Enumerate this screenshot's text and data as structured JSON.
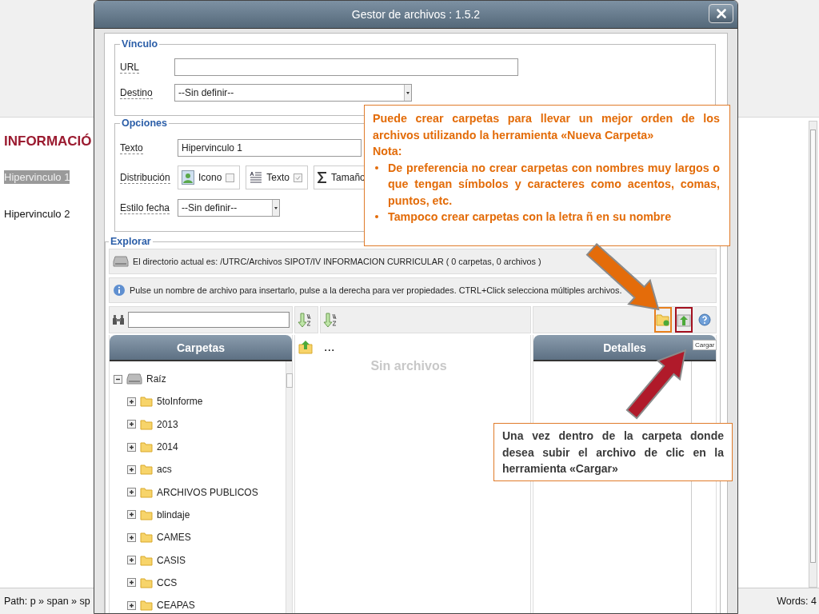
{
  "editor": {
    "heading": "INFORMACIÓ",
    "links": [
      {
        "text": "Hipervinculo 1",
        "selected": true
      },
      {
        "text": "Hipervinculo 2",
        "selected": false
      }
    ],
    "status_path": "Path: p » span » sp",
    "word_count": "Words: 4"
  },
  "dialog": {
    "title": "Gestor de archivos : 1.5.2",
    "vinculo": {
      "legend": "Vínculo",
      "url_label": "URL",
      "destino_label": "Destino",
      "destino_value": "--Sin definir--"
    },
    "opciones": {
      "legend": "Opciones",
      "texto_label": "Texto",
      "texto_value": "Hipervinculo 1",
      "distribucion_label": "Distribución",
      "distribucion": [
        {
          "kind": "icon",
          "label": "Icono",
          "checked": false
        },
        {
          "kind": "text",
          "label": "Texto",
          "checked": true
        },
        {
          "kind": "size",
          "label": "Tamaño"
        }
      ],
      "fecha_label": "Estilo fecha",
      "fecha_value": "--Sin definir--"
    },
    "explorar": {
      "legend": "Explorar",
      "directory": "El directorio actual es: /UTRC/Archivos SIPOT/IV INFORMACION CURRICULAR ( 0 carpetas, 0 archivos )",
      "info": "Pulse un nombre de archivo para insertarlo, pulse a la derecha para ver propiedades. CTRL+Click selecciona múltiples archivos.",
      "tools": [
        {
          "kind": "new-folder",
          "color": "#e8801e"
        },
        {
          "kind": "upload",
          "color": "#a3101f"
        },
        {
          "kind": "help"
        }
      ],
      "folders_header": "Carpetas",
      "details_header": "Detalles",
      "parent_entry": "...",
      "empty_message": "Sin archivos",
      "tree": {
        "label": "Raíz",
        "expanded": true,
        "children": [
          {
            "label": "5toInforme",
            "expanded": false
          },
          {
            "label": "2013",
            "expanded": false
          },
          {
            "label": "2014",
            "expanded": false
          },
          {
            "label": "acs",
            "expanded": false
          },
          {
            "label": "ARCHIVOS PUBLICOS",
            "expanded": false
          },
          {
            "label": "blindaje",
            "expanded": false
          },
          {
            "label": "CAMES",
            "expanded": false
          },
          {
            "label": "CASIS",
            "expanded": false
          },
          {
            "label": "CCS",
            "expanded": false
          },
          {
            "label": "CEAPAS",
            "expanded": false
          }
        ]
      }
    },
    "tooltip": "Cargar"
  },
  "callouts": [
    {
      "kind": "note",
      "paragraph": "Puede crear carpetas para llevar un mejor orden de los archivos utilizando la herramienta «Nueva Carpeta»",
      "note": "Nota:",
      "bullets": [
        "De preferencia no crear carpetas con nombres muy largos o que tengan símbolos y caracteres como acentos, comas, puntos, etc.",
        "Tampoco crear carpetas  con la letra ñ en su nombre"
      ]
    },
    {
      "kind": "plain",
      "paragraph": "Una vez dentro de la carpeta donde desea subir el archivo de clic en la herramienta «Cargar»"
    }
  ]
}
